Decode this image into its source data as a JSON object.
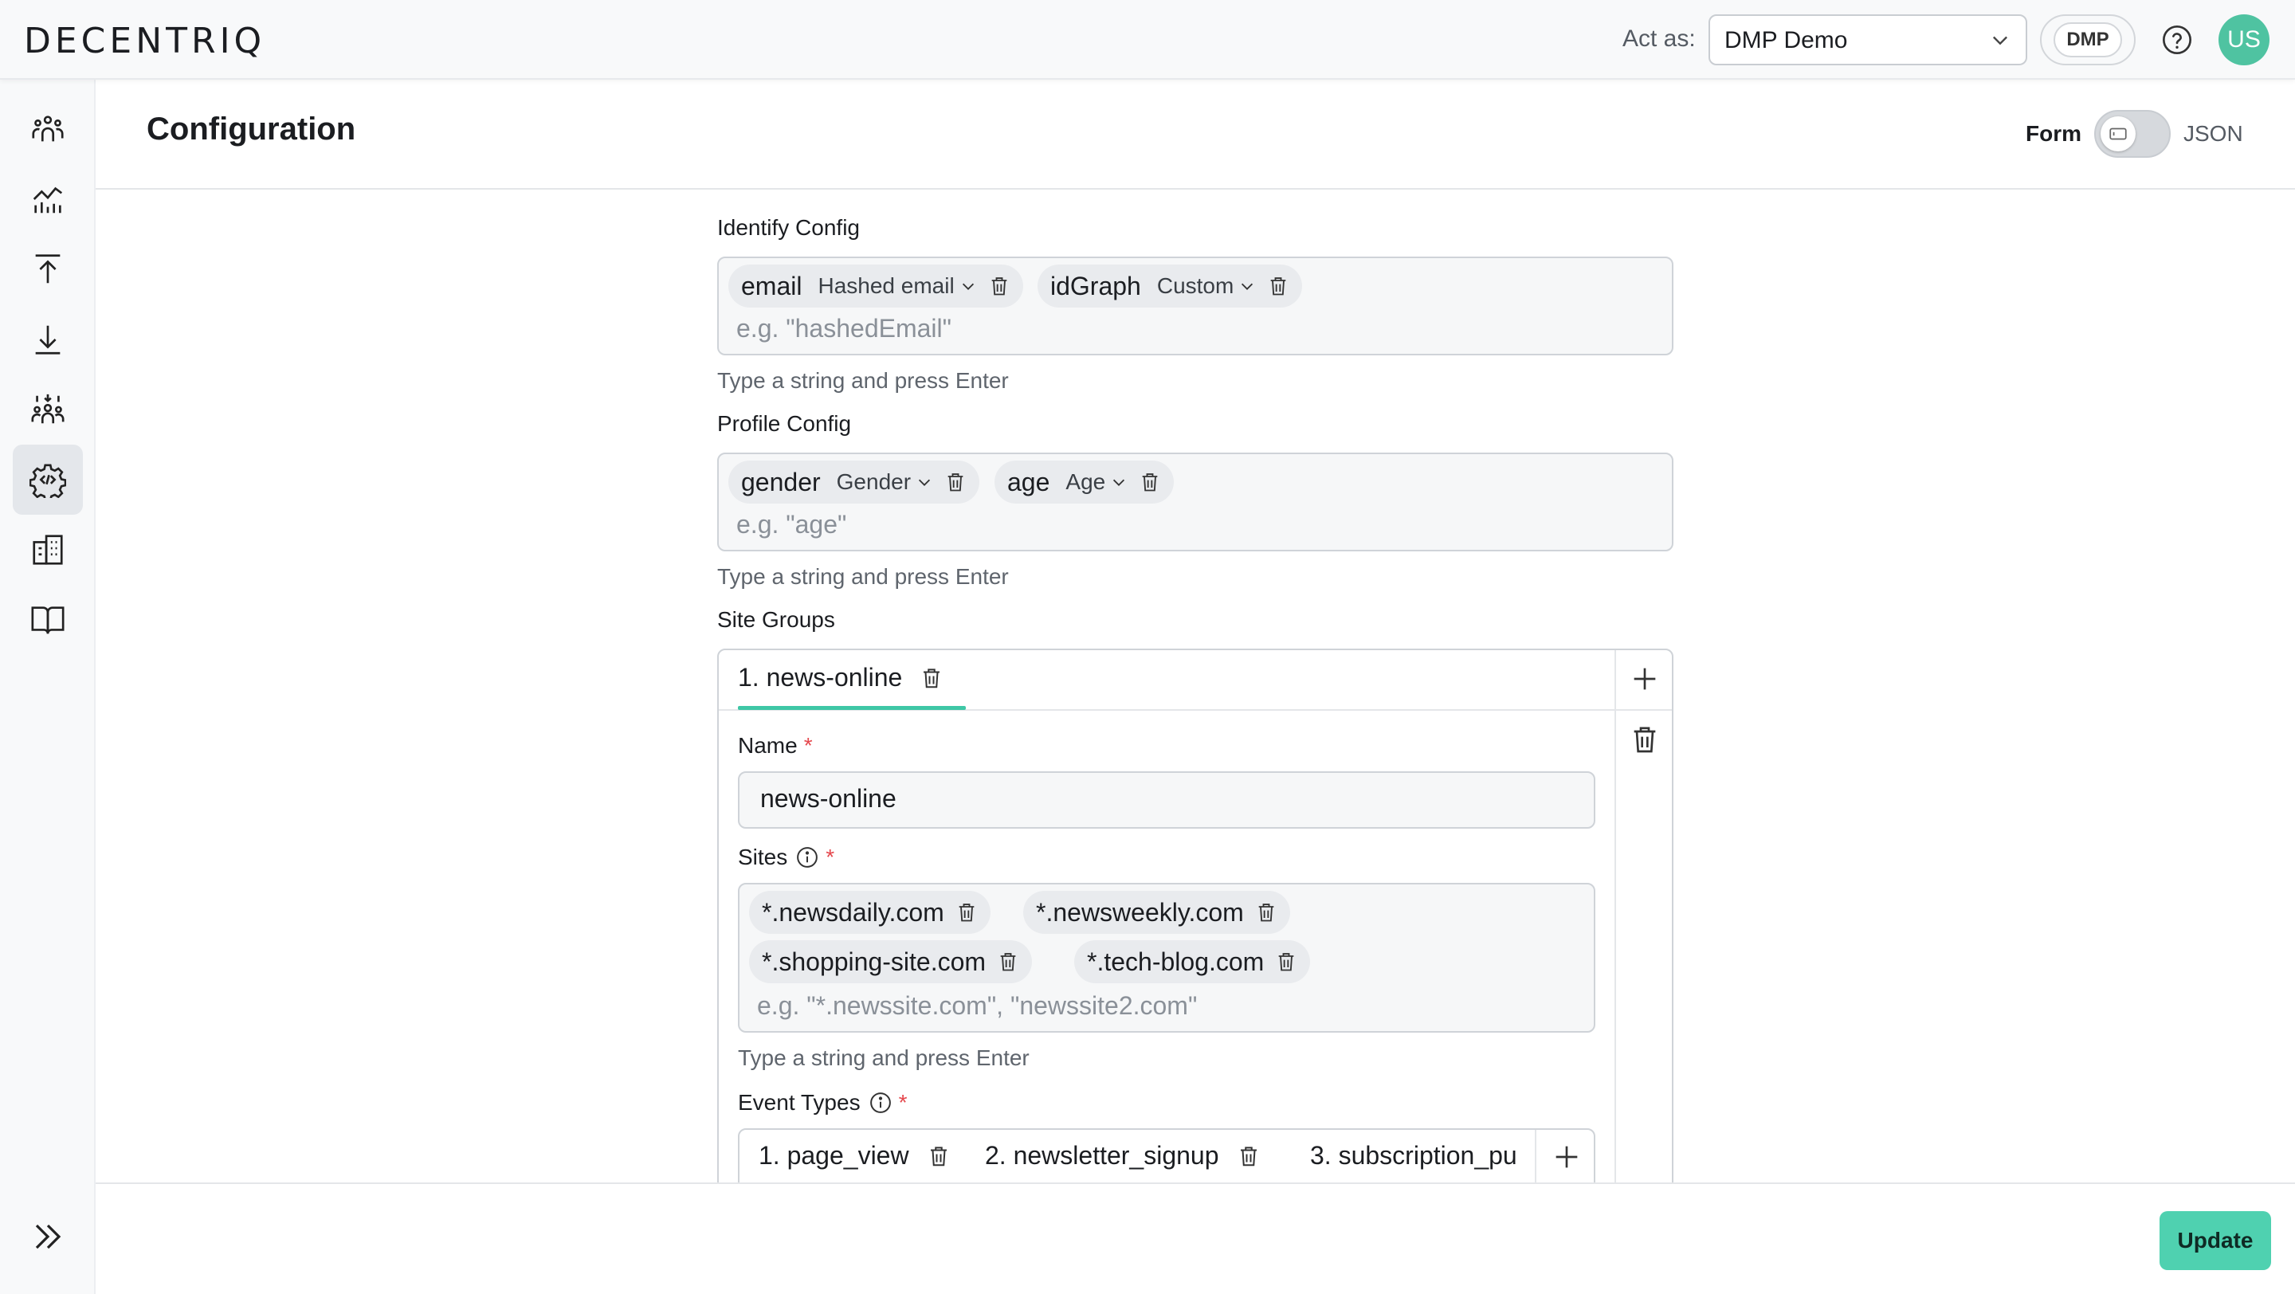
{
  "topbar": {
    "logo": "DECENTRIQ",
    "act_as_label": "Act as:",
    "act_as_value": "DMP Demo",
    "badge": "DMP",
    "avatar_initials": "US"
  },
  "sidebar": {
    "items": [
      {
        "icon": "audiences-icon"
      },
      {
        "icon": "insights-chart-icon"
      },
      {
        "icon": "upload-icon"
      },
      {
        "icon": "download-icon"
      },
      {
        "icon": "collaboration-icon"
      },
      {
        "icon": "settings-code-icon",
        "active": true
      },
      {
        "icon": "organization-building-icon"
      },
      {
        "icon": "documentation-book-icon"
      }
    ],
    "expand_icon": "double-chevron-right-icon"
  },
  "header": {
    "title": "Configuration",
    "mode_form": "Form",
    "mode_json": "JSON"
  },
  "identify_config": {
    "label": "Identify Config",
    "chips": [
      {
        "name": "email",
        "type": "Hashed email"
      },
      {
        "name": "idGraph",
        "type": "Custom"
      }
    ],
    "placeholder": "e.g. \"hashedEmail\"",
    "hint": "Type a string and press Enter"
  },
  "profile_config": {
    "label": "Profile Config",
    "chips": [
      {
        "name": "gender",
        "type": "Gender"
      },
      {
        "name": "age",
        "type": "Age"
      }
    ],
    "placeholder": "e.g. \"age\"",
    "hint": "Type a string and press Enter"
  },
  "site_groups": {
    "label": "Site Groups",
    "tabs": [
      {
        "label": "1. news-online"
      }
    ],
    "name_label": "Name",
    "name_value": "news-online",
    "sites_label": "Sites",
    "sites": [
      "*.newsdaily.com",
      "*.newsweekly.com",
      "*.shopping-site.com",
      "*.tech-blog.com"
    ],
    "sites_placeholder": "e.g. \"*.newssite.com\", \"newssite2.com\"",
    "sites_hint": "Type a string and press Enter",
    "event_types_label": "Event Types",
    "event_types": [
      "1. page_view",
      "2. newsletter_signup",
      "3. subscription_pu"
    ]
  },
  "footer": {
    "update_label": "Update"
  },
  "colors": {
    "accent": "#4fd1b0",
    "tab_underline": "#3ec7a6",
    "required": "#e5484d",
    "avatar": "#4fc3a1"
  }
}
